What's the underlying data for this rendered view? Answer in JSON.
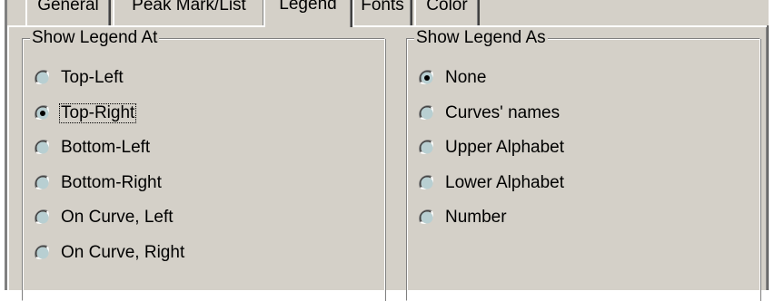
{
  "tabs": [
    {
      "label": "General",
      "active": false
    },
    {
      "label": "Peak Mark/List",
      "active": false
    },
    {
      "label": "Legend",
      "active": true
    },
    {
      "label": "Fonts",
      "active": false
    },
    {
      "label": "Color",
      "active": false
    }
  ],
  "legend_position": {
    "title": "Show Legend At",
    "selected": "Top-Right",
    "focused": "Top-Right",
    "options": [
      "Top-Left",
      "Top-Right",
      "Bottom-Left",
      "Bottom-Right",
      "On Curve, Left",
      "On Curve, Right"
    ]
  },
  "legend_style": {
    "title": "Show Legend As",
    "selected": "None",
    "options": [
      "None",
      "Curves' names",
      "Upper Alphabet",
      "Lower Alphabet",
      "Number"
    ]
  },
  "colors": {
    "face": "#d4d0c8",
    "highlight": "#ffffff",
    "shadow": "#808080",
    "dark_shadow": "#404040",
    "radio_fill": "#b8cfd2"
  }
}
